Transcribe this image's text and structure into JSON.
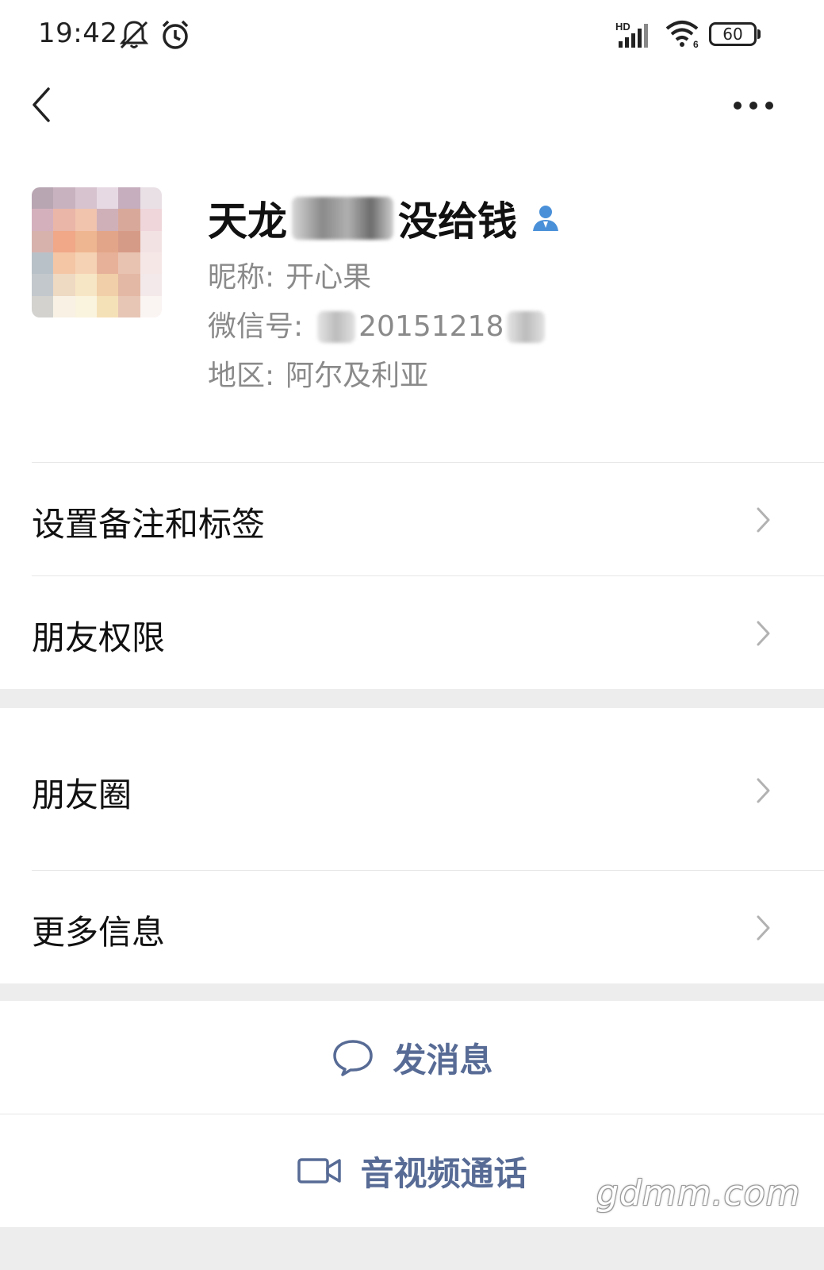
{
  "status_bar": {
    "time": "19:42",
    "network_label": "HD",
    "wifi_label": "6",
    "battery": "60",
    "icons": [
      "mute-icon",
      "alarm-icon",
      "signal-icon",
      "wifi-icon",
      "battery-icon"
    ]
  },
  "nav": {
    "back_icon": "chevron-left-icon",
    "more_icon": "more-dots-icon"
  },
  "profile": {
    "name_prefix": "天龙",
    "name_suffix": "没给钱",
    "nickname_label": "昵称:",
    "nickname": "开心果",
    "wechat_id_label": "微信号:",
    "wechat_id": "20151218",
    "region_label": "地区:",
    "region": "阿尔及利亚"
  },
  "menu": {
    "items": [
      {
        "label": "设置备注和标签"
      },
      {
        "label": "朋友权限"
      },
      {
        "label": "朋友圈"
      },
      {
        "label": "更多信息"
      }
    ]
  },
  "actions": {
    "message": "发消息",
    "call": "音视频通话"
  },
  "colors": {
    "action_blue": "#576b95",
    "section_gray": "#ededed",
    "contact_icon_blue": "#4a90d9"
  },
  "watermark": "gdmm.com"
}
